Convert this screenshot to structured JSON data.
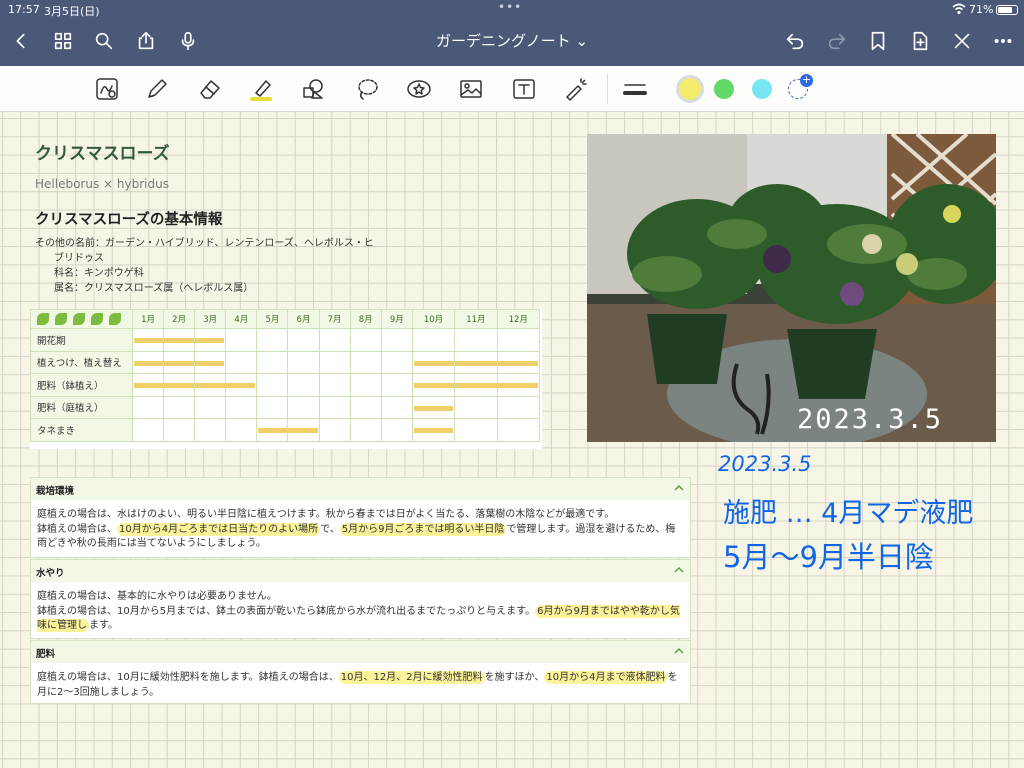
{
  "status": {
    "time": "17:57",
    "date": "3月5日(日)",
    "battery": "71%"
  },
  "nav": {
    "title": "ガーデニングノート ⌄"
  },
  "toolbar": {
    "swatch_colors": [
      "#333333",
      "#f2eb6c",
      "#60d96a",
      "#78e6f2"
    ]
  },
  "note": {
    "title": "クリスマスローズ",
    "scientific": "Helleborus × hybridus",
    "heading": "クリスマスローズの基本情報",
    "info": [
      "その他の名前：ガーデン・ハイブリッド、レンテンローズ、ヘレボルス・ヒ",
      "ブリドゥス",
      "科名：キンポウゲ科",
      "属名：クリスマスローズ属（ヘレボルス属）"
    ]
  },
  "calendar": {
    "months": [
      "1月",
      "2月",
      "3月",
      "4月",
      "5月",
      "6月",
      "7月",
      "8月",
      "9月",
      "10月",
      "11月",
      "12月"
    ],
    "rows": [
      {
        "label": "開花期",
        "ranges": [
          [
            1,
            3
          ]
        ]
      },
      {
        "label": "植えつけ、植え替え",
        "ranges": [
          [
            1,
            3
          ],
          [
            10,
            12
          ]
        ]
      },
      {
        "label": "肥料（鉢植え）",
        "ranges": [
          [
            1,
            4
          ],
          [
            10,
            12
          ]
        ]
      },
      {
        "label": "肥料（庭植え）",
        "ranges": [
          [
            10,
            10
          ]
        ]
      },
      {
        "label": "タネまき",
        "ranges": [
          [
            5,
            6
          ],
          [
            10,
            10
          ]
        ]
      }
    ]
  },
  "photo": {
    "stamp": "2023.3.5"
  },
  "handwriting": {
    "line1": "2023.3.5",
    "line2": "施肥 … 4月マデ液肥",
    "line3": "5月～9月半日陰"
  },
  "panels": {
    "p1": {
      "title": "栽培環境",
      "a": "庭植えの場合は、水はけのよい、明るい半日陰に植えつけます。秋から春までは日がよく当たる、落葉樹の木陰などが最適です。",
      "b": "鉢植えの場合は、",
      "c": "10月から4月ごろまでは日当たりのよい場所",
      "d": "で、",
      "e": "5月から9月ごろまでは明るい半日陰",
      "f": "で管理します。過湿を避けるため、梅雨どきや秋の長雨には当てないようにしましょう。"
    },
    "p2": {
      "title": "水やり",
      "a": "庭植えの場合は、基本的に水やりは必要ありません。",
      "b": "鉢植えの場合は、10月から5月までは、鉢土の表面が乾いたら鉢底から水が流れ出るまでたっぷりと与えます。",
      "c": "6月から9月まではやや乾かし気味に管理し",
      "d": "ます。"
    },
    "p3": {
      "title": "肥料",
      "a": "庭植えの場合は、10月に緩効性肥料を施します。鉢植えの場合は、",
      "b": "10月、12月、2月に緩効性肥料",
      "c": "を施すほか、",
      "d": "10月から4月まで液体肥料",
      "e": "を月に2〜3回施しましょう。"
    }
  }
}
